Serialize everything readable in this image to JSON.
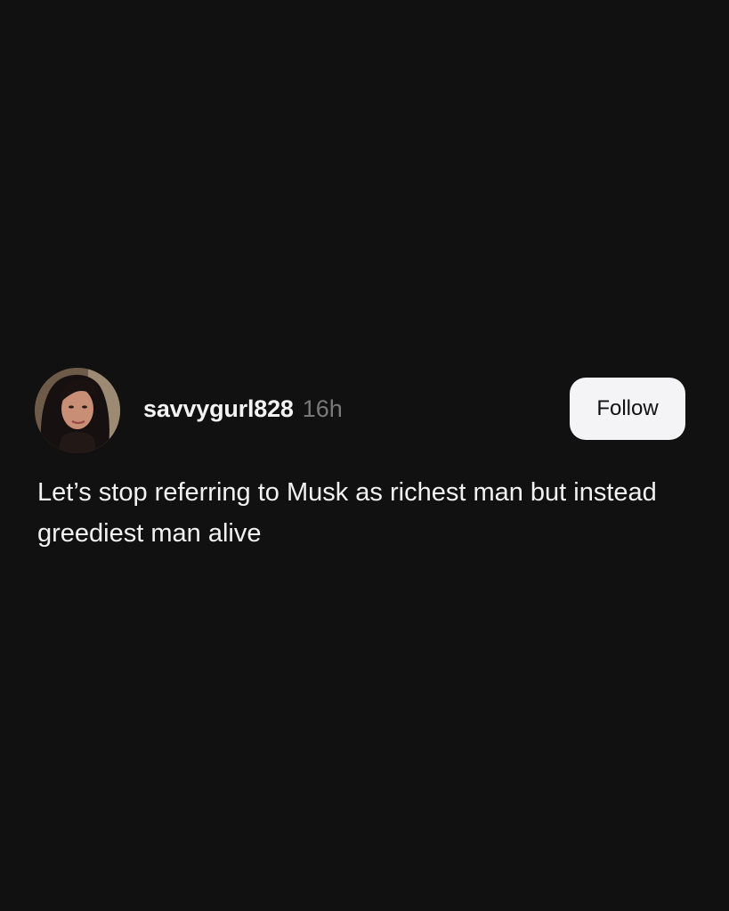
{
  "post": {
    "author": {
      "username": "savvygurl828",
      "avatar_alt": "profile photo"
    },
    "timestamp": "16h",
    "follow_label": "Follow",
    "text": "Let’s stop referring to Musk as richest man but instead greediest man alive"
  },
  "colors": {
    "background": "#111111",
    "text_primary": "#f2f2f2",
    "text_secondary": "#7a7a7a",
    "button_bg": "#f4f4f6",
    "button_text": "#111111"
  }
}
